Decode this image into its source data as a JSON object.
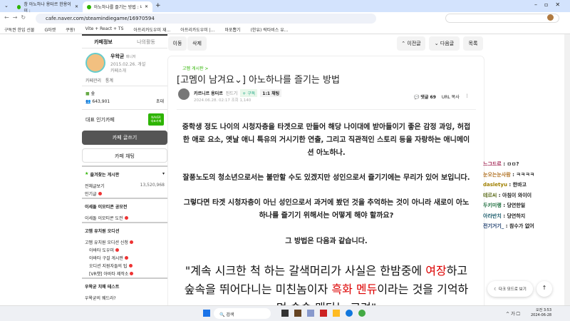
{
  "browser": {
    "tabs": [
      "창 아노하나 용터르 한용이이 :",
      "아노하나를 즐기는 방법 : 네이"
    ],
    "url": "cafe.naver.com/steamindiegame/16970594",
    "bookmarks": [
      "구독권 한입 선물",
      "G마켓",
      "쿠팡!",
      "Vite + React + TS",
      "아프리카도우미 재...",
      "아프리카도우미 |...",
      "마포뽑기",
      "(한유) 락타비스 유..."
    ]
  },
  "sidebar": {
    "tabs": [
      "카페정보",
      "나의활동"
    ],
    "cafe_name": "우왁굳",
    "role": "매니저",
    "date": "2015.02.26. 개설",
    "intro": "카페소개",
    "manage": "카페관리",
    "stats": "통계",
    "level": "숲",
    "members": "643,901",
    "invite": "초대",
    "popular": "대표 인기카페",
    "badge": "NAVER 대표카페",
    "write": "카페 글쓰기",
    "chat": "카페 채팅",
    "fav_title": "즐겨찾는 게시판",
    "all_posts": "전체글보기",
    "all_count": "13,520,968",
    "popular_posts": "인기글",
    "sections": [
      {
        "title": "이세돌 이모티콘 공모전",
        "items": [
          "이세돌 이모티콘 도전"
        ]
      },
      {
        "title": "고멤 유치원 오디션",
        "items": [
          "고멤 유치원 오디션 신청",
          "아바타 도우미",
          "아바타 구걸 게시판",
          "오디션 지원자들의 팁",
          "[VR챗] 아바타 제작소"
        ]
      },
      {
        "title": "우왁굳 치매 테스트",
        "items": [
          "우왁굳의 웨드라?"
        ]
      }
    ]
  },
  "toolbar": {
    "edit": "이동",
    "delete": "삭제",
    "prev": "이전글",
    "next": "다음글",
    "list": "목록"
  },
  "article": {
    "board": "고멤 게시판 >",
    "title": "[고멤이 남겨요⌄] 아노하나를 즐기는 방법",
    "author": "카르니르 용터르",
    "grade": "진드기",
    "subscribe": "+ 구독",
    "chat": "1:1 채팅",
    "meta": "2024.06.28. 02:17  조회 1,140",
    "comments": "댓글 69",
    "url_copy": "URL 복사",
    "paragraphs": [
      "중학생 정도 나이의 시청자층을 타겟으로 만들어 해당 나이대에 받아들이기 좋은 감정 과잉, 허접",
      "한 애로 요소, 옛날 애니 특유의 거시기한 연출, 그리고 직관적인 스토리 등을 자랑하는 애니메이",
      "션 아노하나.",
      "잘풍노도의 청소년으로서는 불만할 수도 있겠지만 성인으로서 즐기기에는 무리가 있어 보입니다.",
      "그렇다면 타겟 시청자층이 아닌 성인으로서 과거에 봤던 것을 추억하는 것이 아니라 새로이 아노",
      "하나를 즐기기 위해서는 어떻게 해야 할까요?",
      "그 방법은 다음과 같습니다."
    ],
    "quote": [
      "\"계속 시크한 척 하는 갈색머리가 사실은 한밤중에 ",
      "여장",
      "하고",
      "숲속을 뛰어다니는 미친놈이자 ",
      "흑화 멘듀",
      "이라는 것을 기억하",
      "며 술술 맨다는 고려\""
    ]
  },
  "chat_overlay": [
    {
      "name": "느그드르",
      "msg": "ㅁㅁ?",
      "color": "#a02050"
    },
    {
      "name": "눈오는눈사람",
      "msg": "ㅋㅋㅋㅋ",
      "color": "#b07020"
    },
    {
      "name": "dasletyu",
      "msg": "한바고",
      "color": "#a08000"
    },
    {
      "name": "테르씨",
      "msg": "아침이 와이이",
      "color": "#607020"
    },
    {
      "name": "두키미랭",
      "msg": "당연한일",
      "color": "#207040"
    },
    {
      "name": "아라반치",
      "msg": "당연하지",
      "color": "#206070"
    },
    {
      "name": "전기거기_",
      "msg": "참수가 없어",
      "color": "#204070"
    }
  ],
  "floating": {
    "dark_mode": "다크 모드로 보기",
    "top": "↑"
  },
  "taskbar": {
    "search": "검색",
    "ime": "가",
    "time": "오전 3:53",
    "date": "2024-06-28"
  }
}
